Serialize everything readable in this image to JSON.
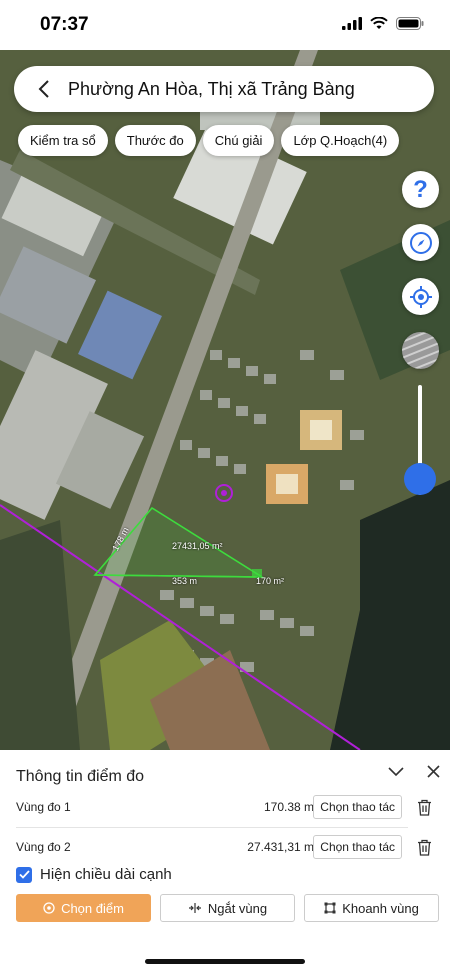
{
  "status": {
    "time": "07:37"
  },
  "header": {
    "title": "Phường An Hòa, Thị xã Trảng Bàng"
  },
  "chips": [
    "Kiểm tra sổ",
    "Thước đo",
    "Chú giải",
    "Lớp Q.Hoạch(4)"
  ],
  "map": {
    "side_label": "178 m",
    "area_label": "27431,05 m²",
    "base_label": "353 m",
    "small_area_label": "170 m²",
    "zoom_level": 0.15,
    "colors": {
      "measure_line": "#3ddc3d",
      "boundary_line": "#b020d8",
      "accent": "#2f6fe8"
    }
  },
  "panel": {
    "title": "Thông tin điểm đo",
    "rows": [
      {
        "name": "Vùng đo 1",
        "area": "170.38 m²",
        "action": "Chọn thao tác"
      },
      {
        "name": "Vùng đo 2",
        "area": "27.431,31 m²",
        "action": "Chọn thao tác"
      }
    ],
    "checkbox_label": "Hiện chiều dài cạnh",
    "buttons": {
      "select_point": "Chọn điểm",
      "split_zone": "Ngắt vùng",
      "enclose_zone": "Khoanh vùng"
    }
  }
}
